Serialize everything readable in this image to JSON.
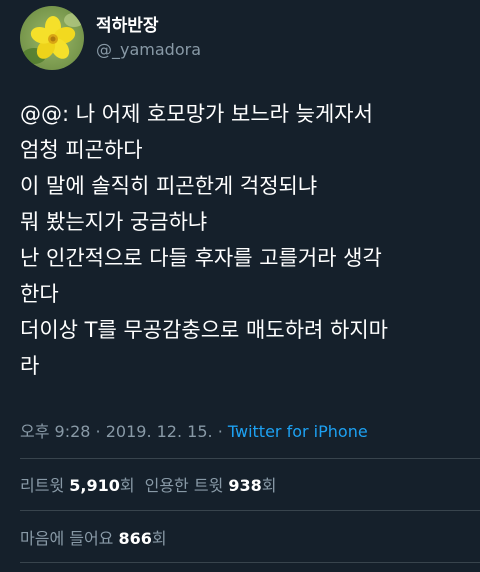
{
  "user": {
    "display_name": "적하반장",
    "handle": "@_yamadora",
    "avatar_icon": "yellow-flower-avatar"
  },
  "tweet": {
    "lines": [
      "@@: 나 어제 호모망가 보느라 늦게자서",
      "엄청 피곤하다",
      "이 말에 솔직히 피곤한게 걱정되냐",
      "뭐 봤는지가 궁금하냐",
      "난 인간적으로 다들 후자를 고를거라 생각",
      "한다",
      "더이상 T를 무공감충으로 매도하려 하지마",
      "라"
    ],
    "time": "오후 9:28",
    "separator": " · ",
    "date": "2019. 12. 15.",
    "source": "Twitter for iPhone"
  },
  "stats": {
    "retweets_label": "리트윗",
    "retweets_count": "5,910",
    "retweets_unit": "회",
    "quotes_label": "인용한 트윗",
    "quotes_count": "938",
    "quotes_unit": "회",
    "likes_label": "마음에 들어요",
    "likes_count": "866",
    "likes_unit": "회"
  },
  "colors": {
    "background": "#15202b",
    "secondary_text": "#8899a6",
    "link": "#1da1f2",
    "divider": "#38444d"
  }
}
